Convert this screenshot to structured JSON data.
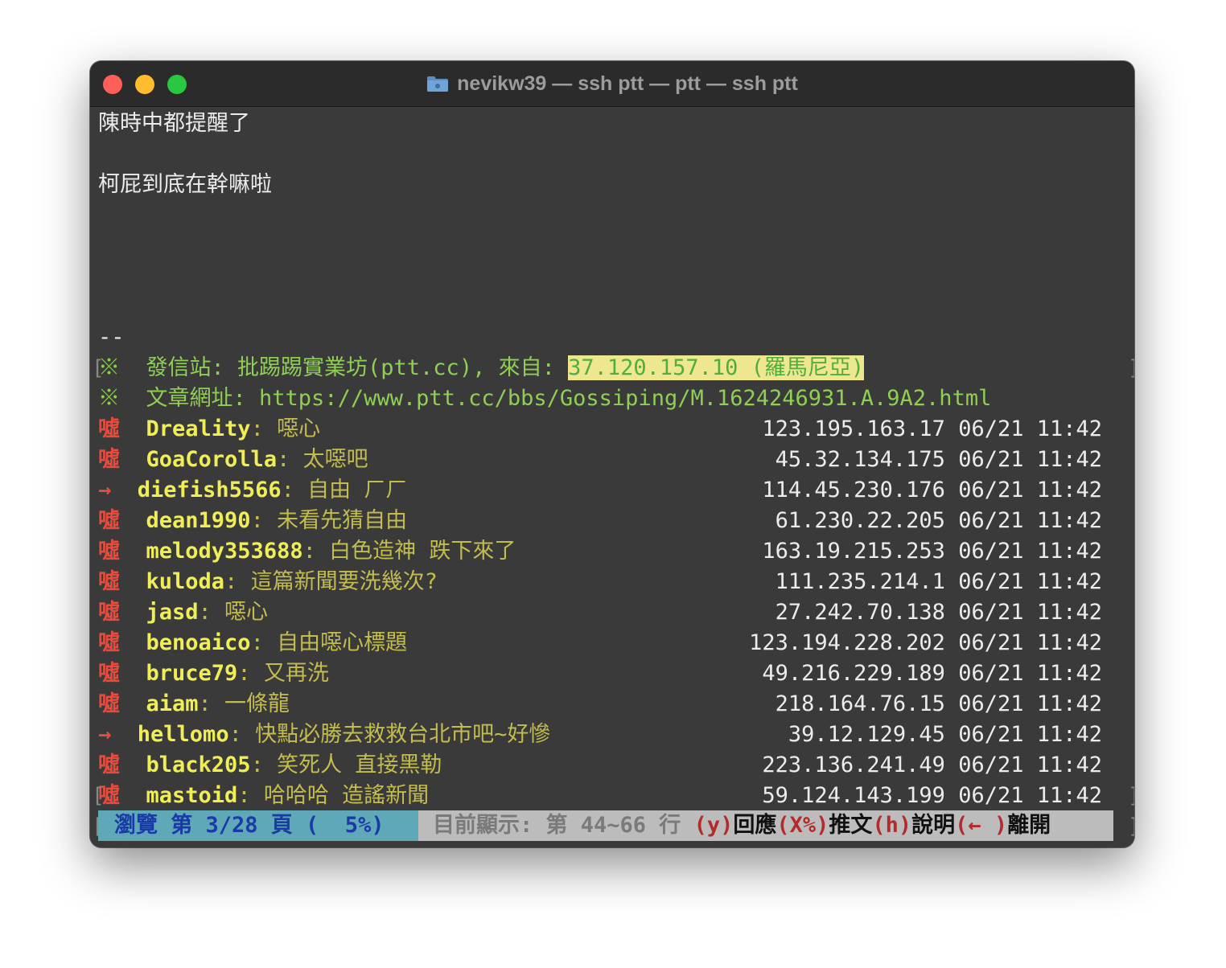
{
  "window": {
    "title": "nevikw39 — ssh ptt — ptt — ssh ptt"
  },
  "article": {
    "body_line1": "陳時中都提醒了",
    "body_line2": "柯屁到底在幹嘛啦",
    "sig_sep": "--",
    "source_mark": "※",
    "source_label": "發信站: 批踢踢實業坊(ptt.cc), 來自: ",
    "source_ip": "37.120.157.10 (羅馬尼亞)",
    "url_mark": "※",
    "url_label": "文章網址: ",
    "url": "https://www.ptt.cc/bbs/Gossiping/M.1624246931.A.9A2.html"
  },
  "comments": [
    {
      "tag": "噓",
      "user": "Dreality",
      "text": ": 噁心",
      "ip": "123.195.163.17",
      "time": "06/21 11:42"
    },
    {
      "tag": "噓",
      "user": "GoaCorolla",
      "text": ": 太噁吧",
      "ip": "45.32.134.175",
      "time": "06/21 11:42"
    },
    {
      "tag": "→",
      "user": "diefish5566",
      "text": ": 自由 ㄏㄏ",
      "ip": "114.45.230.176",
      "time": "06/21 11:42"
    },
    {
      "tag": "噓",
      "user": "dean1990",
      "text": ": 未看先猜自由",
      "ip": "61.230.22.205",
      "time": "06/21 11:42"
    },
    {
      "tag": "噓",
      "user": "melody353688",
      "text": ": 白色造神 跌下來了",
      "ip": "163.19.215.253",
      "time": "06/21 11:42"
    },
    {
      "tag": "噓",
      "user": "kuloda",
      "text": ": 這篇新聞要洗幾次?",
      "ip": "111.235.214.1",
      "time": "06/21 11:42"
    },
    {
      "tag": "噓",
      "user": "jasd",
      "text": ": 噁心",
      "ip": "27.242.70.138",
      "time": "06/21 11:42"
    },
    {
      "tag": "噓",
      "user": "benoaico",
      "text": ": 自由噁心標題",
      "ip": "123.194.228.202",
      "time": "06/21 11:42"
    },
    {
      "tag": "噓",
      "user": "bruce79",
      "text": ": 又再洗",
      "ip": "49.216.229.189",
      "time": "06/21 11:42"
    },
    {
      "tag": "噓",
      "user": "aiam",
      "text": ": 一條龍",
      "ip": "218.164.76.15",
      "time": "06/21 11:42"
    },
    {
      "tag": "→",
      "user": "hellomo",
      "text": ": 快點必勝去救救台北市吧~好慘",
      "ip": "39.12.129.45",
      "time": "06/21 11:42"
    },
    {
      "tag": "噓",
      "user": "black205",
      "text": ": 笑死人 直接黑勒",
      "ip": "223.136.241.49",
      "time": "06/21 11:42"
    },
    {
      "tag": "噓",
      "user": "mastoid",
      "text": ": 哈哈哈 造謠新聞",
      "ip": "59.124.143.199",
      "time": "06/21 11:42"
    }
  ],
  "status": {
    "browse": "瀏覽 第 3/28 頁 (  5%)",
    "showing": "目前顯示: 第 44~66 行 ",
    "key_reply": "(y)",
    "label_reply": "回應",
    "key_push": "(X%)",
    "label_push": "推文",
    "key_help": "(h)",
    "label_help": "說明",
    "key_leave": "(← )",
    "label_leave": "離開"
  },
  "colors": {
    "boo_tag": "#e84a3c",
    "user": "#f0ee56",
    "comment": "#c3bc4f",
    "source": "#8fcf54",
    "status_bar": "#bcbcbc",
    "status_left": "#5ea8b8"
  }
}
